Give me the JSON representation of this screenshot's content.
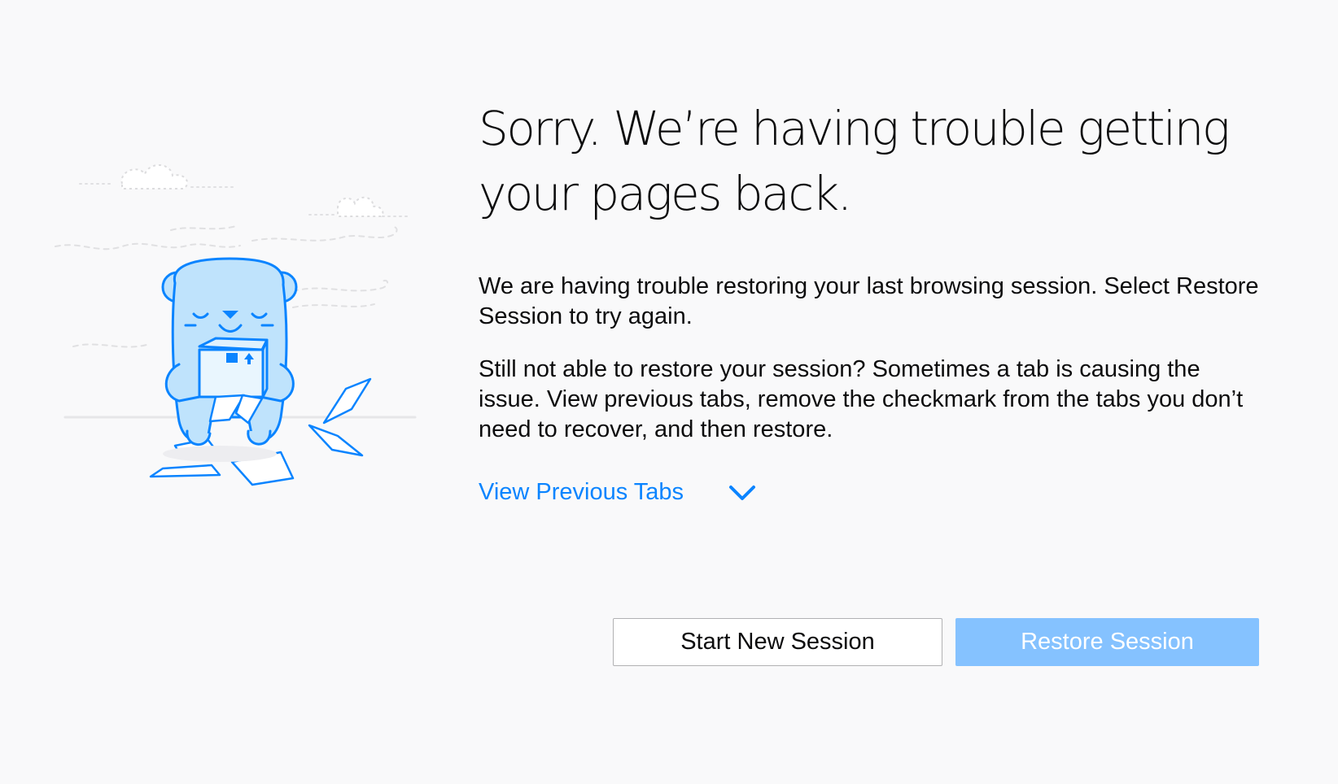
{
  "page": {
    "title": "Sorry. We’re having trouble getting your pages back.",
    "description": "We are having trouble restoring your last browsing session. Select Restore Session to try again.",
    "description_2": "Still not able to restore your session? Sometimes a tab is causing the issue. View previous tabs, remove the checkmark from the tabs you don’t need to recover, and then restore.",
    "view_tabs_label": "View Previous Tabs",
    "view_tabs_icon": "chevron-down-icon"
  },
  "buttons": {
    "start_new": "Start New Session",
    "restore": "Restore Session"
  },
  "colors": {
    "background": "#f9f9fa",
    "link": "#0a84ff",
    "primary_button_disabled": "#85c2ff",
    "illustration_blue": "#0a84ff",
    "illustration_fill": "#bfe3fc"
  },
  "illustration": {
    "icon": "bear-with-box-illustration"
  }
}
